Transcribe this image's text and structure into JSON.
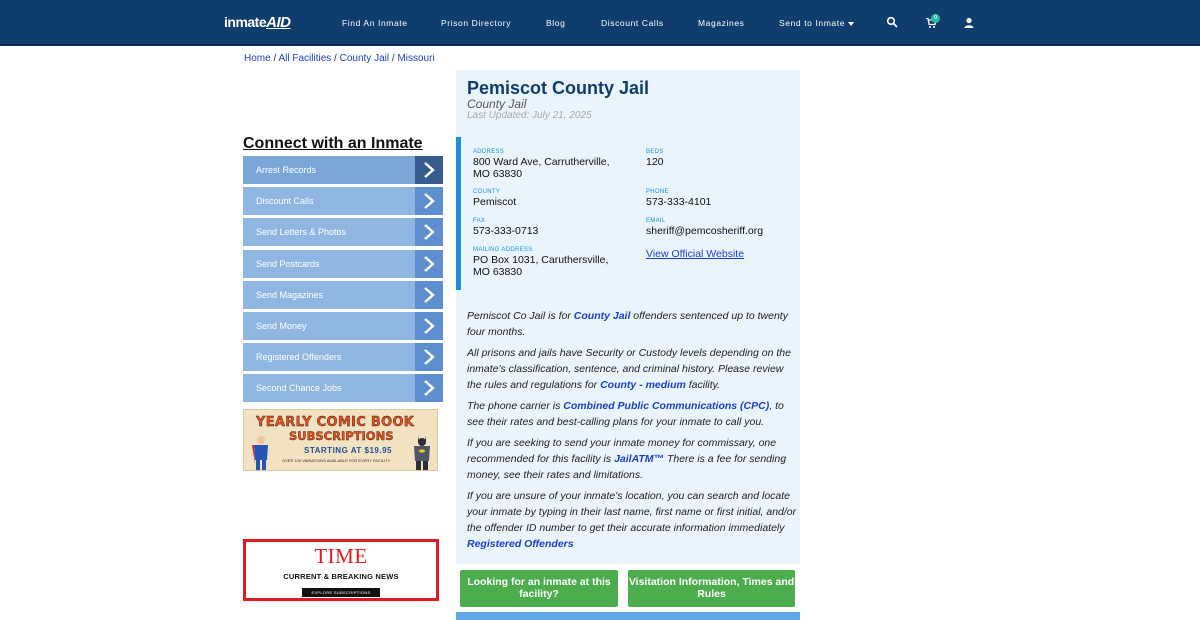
{
  "nav": {
    "logo_main": "inmate",
    "logo_accent": "AID",
    "links": [
      "Find An Inmate",
      "Prison Directory",
      "Blog",
      "Discount Calls",
      "Magazines",
      "Send to Inmate"
    ],
    "cart_count": "0",
    "icons": [
      "search-icon",
      "cart-icon",
      "user-icon"
    ]
  },
  "breadcrumb": {
    "home": "Home",
    "sep": " / ",
    "all_facilities": "All Facilities",
    "county_jail": "County Jail",
    "missouri": "Missouri"
  },
  "sidebar": {
    "title": "Connect with an Inmate",
    "items": [
      "Arrest Records",
      "Discount Calls",
      "Send Letters & Photos",
      "Send Postcards",
      "Send Magazines",
      "Send Money",
      "Registered Offenders",
      "Second Chance Jobs"
    ]
  },
  "ads": {
    "comic_line1": "YEARLY COMIC BOOK",
    "comic_line2": "SUBSCRIPTIONS",
    "comic_line3": "STARTING AT $19.95",
    "comic_line4": "OVER 100 VARIATIONS AVAILABLE FOR EVERY FACILITY",
    "time_brand": "TIME",
    "time_tag": "CURRENT & BREAKING NEWS",
    "time_button": "EXPLORE SUBSCRIPTIONS"
  },
  "facility": {
    "name": "Pemiscot County Jail",
    "type": "County Jail",
    "updated": "Last Updated: July 21, 2025",
    "address_label": "ADDRESS",
    "address_line1": "800 Ward Ave, Carrutherville,",
    "address_line2": "MO 63830",
    "beds_label": "BEDS",
    "beds": "120",
    "county_label": "COUNTY",
    "county": "Pemiscot",
    "phone_label": "PHONE",
    "phone": "573-333-4101",
    "fax_label": "FAX",
    "fax": "573-333-0713",
    "email_label": "EMAIL",
    "email": "sheriff@pemcosheriff.org",
    "website": "View Official Website",
    "mailing_label": "MAILING ADDRESS",
    "mailing_line1": "PO Box 1031, Caruthersville,",
    "mailing_line2": "MO 63830"
  },
  "description": {
    "p1_a": "Pemiscot Co Jail is for ",
    "p1_link": "County Jail",
    "p1_b": " offenders sentenced up to twenty four months.",
    "p2_a": "All prisons and jails have Security or Custody levels depending on the inmate's classification, sentence, and criminal history. Please review the rules and regulations for ",
    "p2_link": "County - medium",
    "p2_b": " facility.",
    "p3_a": "The phone carrier is ",
    "p3_link": "Combined Public Communications (CPC)",
    "p3_b": ", to see their rates and best-calling plans for your inmate to call you.",
    "p4_a": "If you are seeking to send your inmate money for commissary, one recommended for this facility is ",
    "p4_link": "JailATM™",
    "p4_b": " There is a fee for sending money, see their rates and limitations.",
    "p5_a": "If you are unsure of your inmate's location, you can search and locate your inmate by typing in their last name, first name or first initial, and/or the offender ID number to get their accurate information immediately",
    "p5_link": "Registered Offenders"
  },
  "buttons": {
    "looking": "Looking for an inmate at this facility?",
    "visitation": "Visitation Information, Times and Rules"
  },
  "colors": {
    "nav_bg": "#0f3d6e",
    "accent_blue": "#1b8fe0",
    "button_green": "#4cad4c",
    "menu_blue": "#8fb6e1"
  }
}
